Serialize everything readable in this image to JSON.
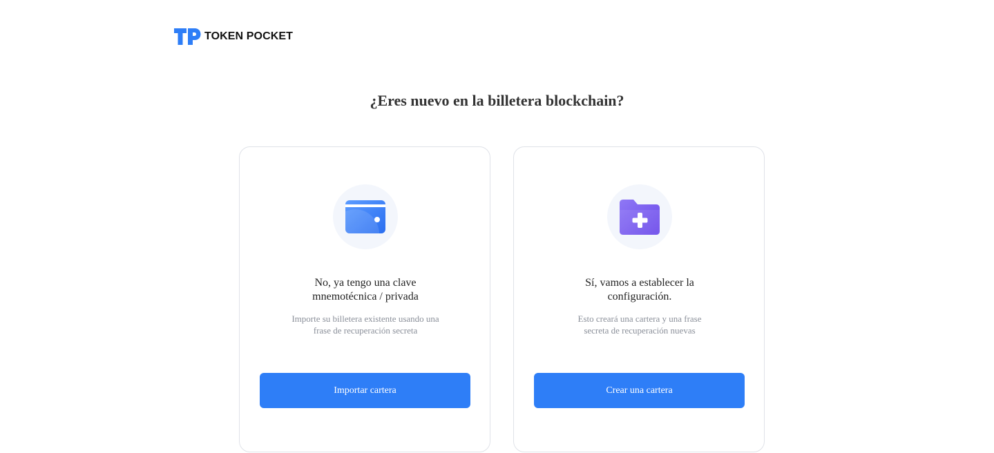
{
  "header": {
    "brand_name": "TOKEN POCKET",
    "brand_color": "#2e7ef7"
  },
  "main": {
    "title": "¿Eres nuevo en la billetera blockchain?"
  },
  "cards": [
    {
      "icon": "wallet-icon",
      "title_line1": "No, ya tengo una clave",
      "title_line2": "mnemotécnica / privada",
      "desc_line1": "Importe su billetera existente usando una",
      "desc_line2": "frase de recuperación secreta",
      "button_label": "Importar cartera"
    },
    {
      "icon": "folder-plus-icon",
      "title_line1": "Sí, vamos a establecer la",
      "title_line2": "configuración.",
      "desc_line1": "Esto creará una cartera y una frase",
      "desc_line2": "secreta de recuperación nuevas",
      "button_label": "Crear una cartera"
    }
  ],
  "colors": {
    "primary_button": "#2e7ef7",
    "card_border": "#dfe2e8",
    "icon_circle_bg": "#f3f6fc",
    "folder_purple": "#7b5cf0"
  }
}
